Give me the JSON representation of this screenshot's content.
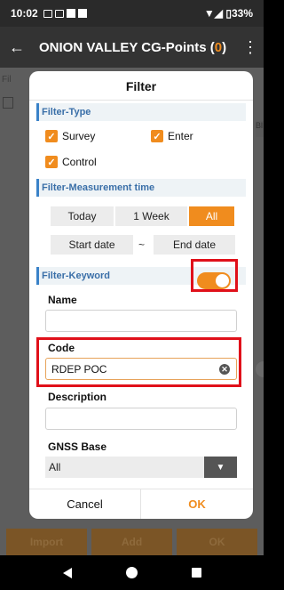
{
  "status_bar": {
    "time": "10:02",
    "notif_icons": [
      "mail-icon",
      "calendar-icon"
    ],
    "battery": "33%"
  },
  "header": {
    "title": "ONION VALLEY CG-Points",
    "count": "0",
    "count_open": " (",
    "count_close": ")"
  },
  "background": {
    "filter_stub": "Fil",
    "right_stub": "Bl",
    "buttons": [
      "Import",
      "Add",
      "OK"
    ]
  },
  "dialog": {
    "title": "Filter",
    "sections": {
      "type": "Filter-Type",
      "time": "Filter-Measurement time",
      "keyword": "Filter-Keyword"
    },
    "type_options": [
      {
        "label": "Survey",
        "checked": true
      },
      {
        "label": "Enter",
        "checked": true
      },
      {
        "label": "Control",
        "checked": true
      }
    ],
    "time_options": [
      "Today",
      "1 Week",
      "All"
    ],
    "time_selected": "All",
    "start_date": "Start date",
    "end_date": "End date",
    "date_sep": "~",
    "keyword_enabled": true,
    "fields": {
      "name_label": "Name",
      "name_value": "",
      "code_label": "Code",
      "code_value": "RDEP POC",
      "description_label": "Description",
      "description_value": ""
    },
    "gnss_base_label": "GNSS Base",
    "gnss_base_value": "All",
    "cancel": "Cancel",
    "ok": "OK"
  },
  "colors": {
    "accent": "#f08c1e",
    "section_text": "#3a6fa8",
    "highlight": "#e0101a"
  }
}
